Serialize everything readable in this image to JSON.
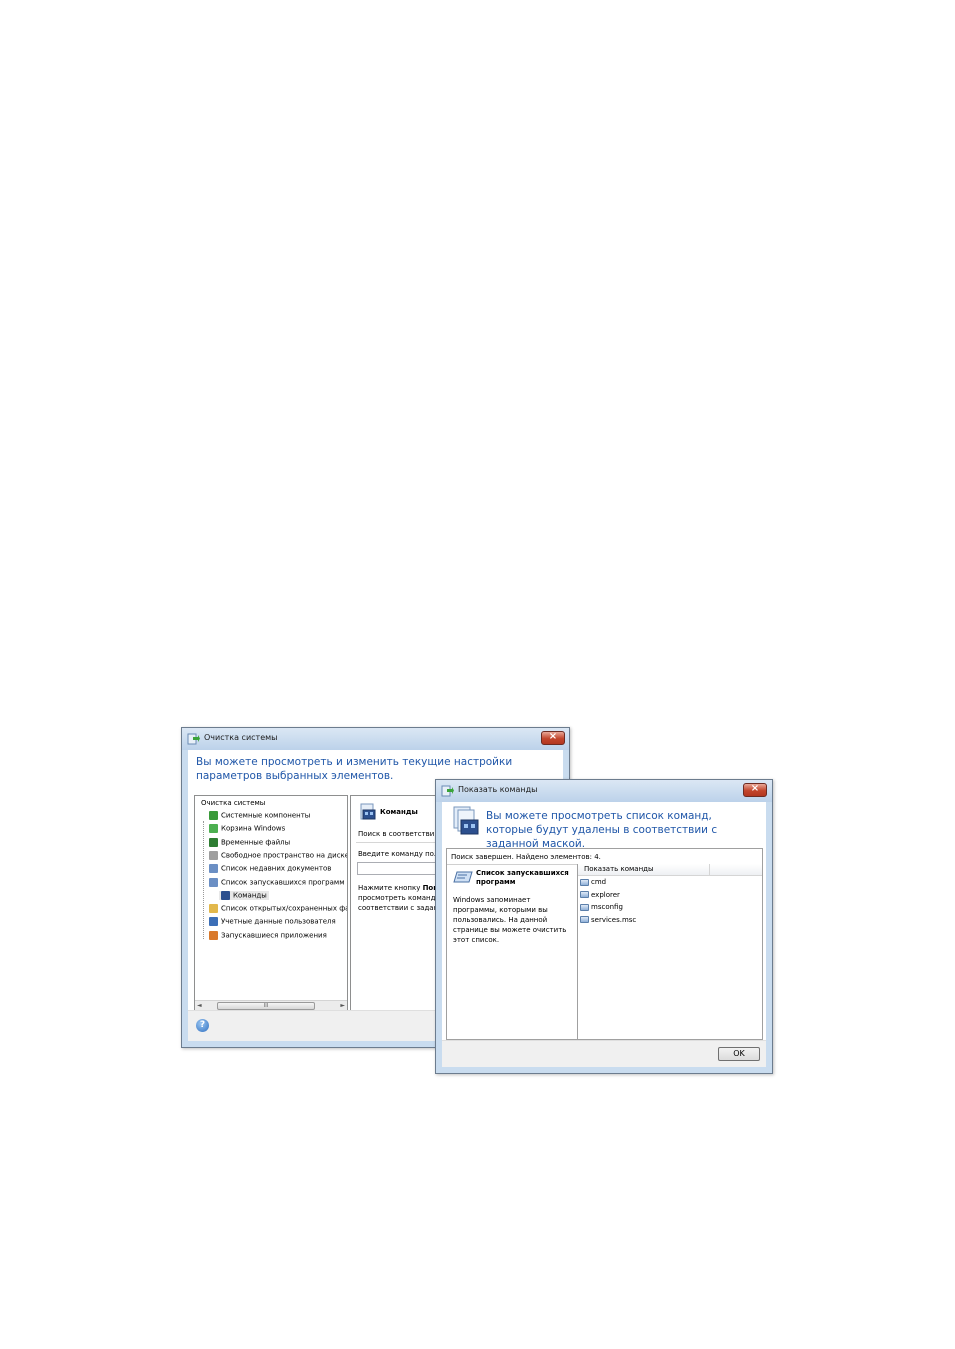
{
  "main_window": {
    "title": "Очистка системы",
    "heading": "Вы можете просмотреть и изменить текущие настройки параметров выбранных элементов.",
    "tree": {
      "root": "Очистка системы",
      "items": [
        {
          "label": "Системные компоненты",
          "icon": "windows-logo-icon",
          "color": "#3a9a3a"
        },
        {
          "label": "Корзина Windows",
          "icon": "recycle-bin-icon",
          "color": "#4caf50"
        },
        {
          "label": "Временные файлы",
          "icon": "temp-files-icon",
          "color": "#2e7d32"
        },
        {
          "label": "Свободное пространство на диске",
          "icon": "disk-icon",
          "color": "#9e9e9e"
        },
        {
          "label": "Список недавних документов",
          "icon": "documents-icon",
          "color": "#6b8fc4"
        },
        {
          "label": "Список запускавшихся программ",
          "icon": "run-icon",
          "color": "#6b8fc4"
        },
        {
          "label": "Команды",
          "icon": "commands-icon",
          "color": "#2c4f8e"
        },
        {
          "label": "Список открытых/сохраненных фа",
          "icon": "folder-icon",
          "color": "#e2b84c"
        },
        {
          "label": "Учетные данные пользователя",
          "icon": "user-icon",
          "color": "#3c6fb7"
        },
        {
          "label": "Запускавшиеся приложения",
          "icon": "apps-icon",
          "color": "#d9792b"
        }
      ]
    },
    "right_panel": {
      "title": "Команды",
      "search_label": "Поиск в соответствии с",
      "input_label": "Введите команду полно",
      "hint_prefix": "Нажмите кнопку ",
      "hint_bold": "Пока",
      "hint_line2": "просмотреть команды",
      "hint_line3": "соответствии с задан"
    },
    "scrollbar_grip": "III"
  },
  "dialog": {
    "title": "Показать команды",
    "heading": "Вы можете просмотреть список команд, которые будут удалены в соответствии с заданной маской.",
    "status": "Поиск завершен. Найдено элементов: 4.",
    "left_title": "Список запускавшихся программ",
    "left_description": "Windows запоминает программы, которыми вы пользовались. На данной странице вы можете очистить этот список.",
    "column_header": "Показать команды",
    "commands": [
      "cmd",
      "explorer",
      "msconfig",
      "services.msc"
    ],
    "ok_label": "OK"
  },
  "colors": {
    "accent": "#1f56a8",
    "frame": "#c9dcef",
    "close": "#c2452c"
  }
}
